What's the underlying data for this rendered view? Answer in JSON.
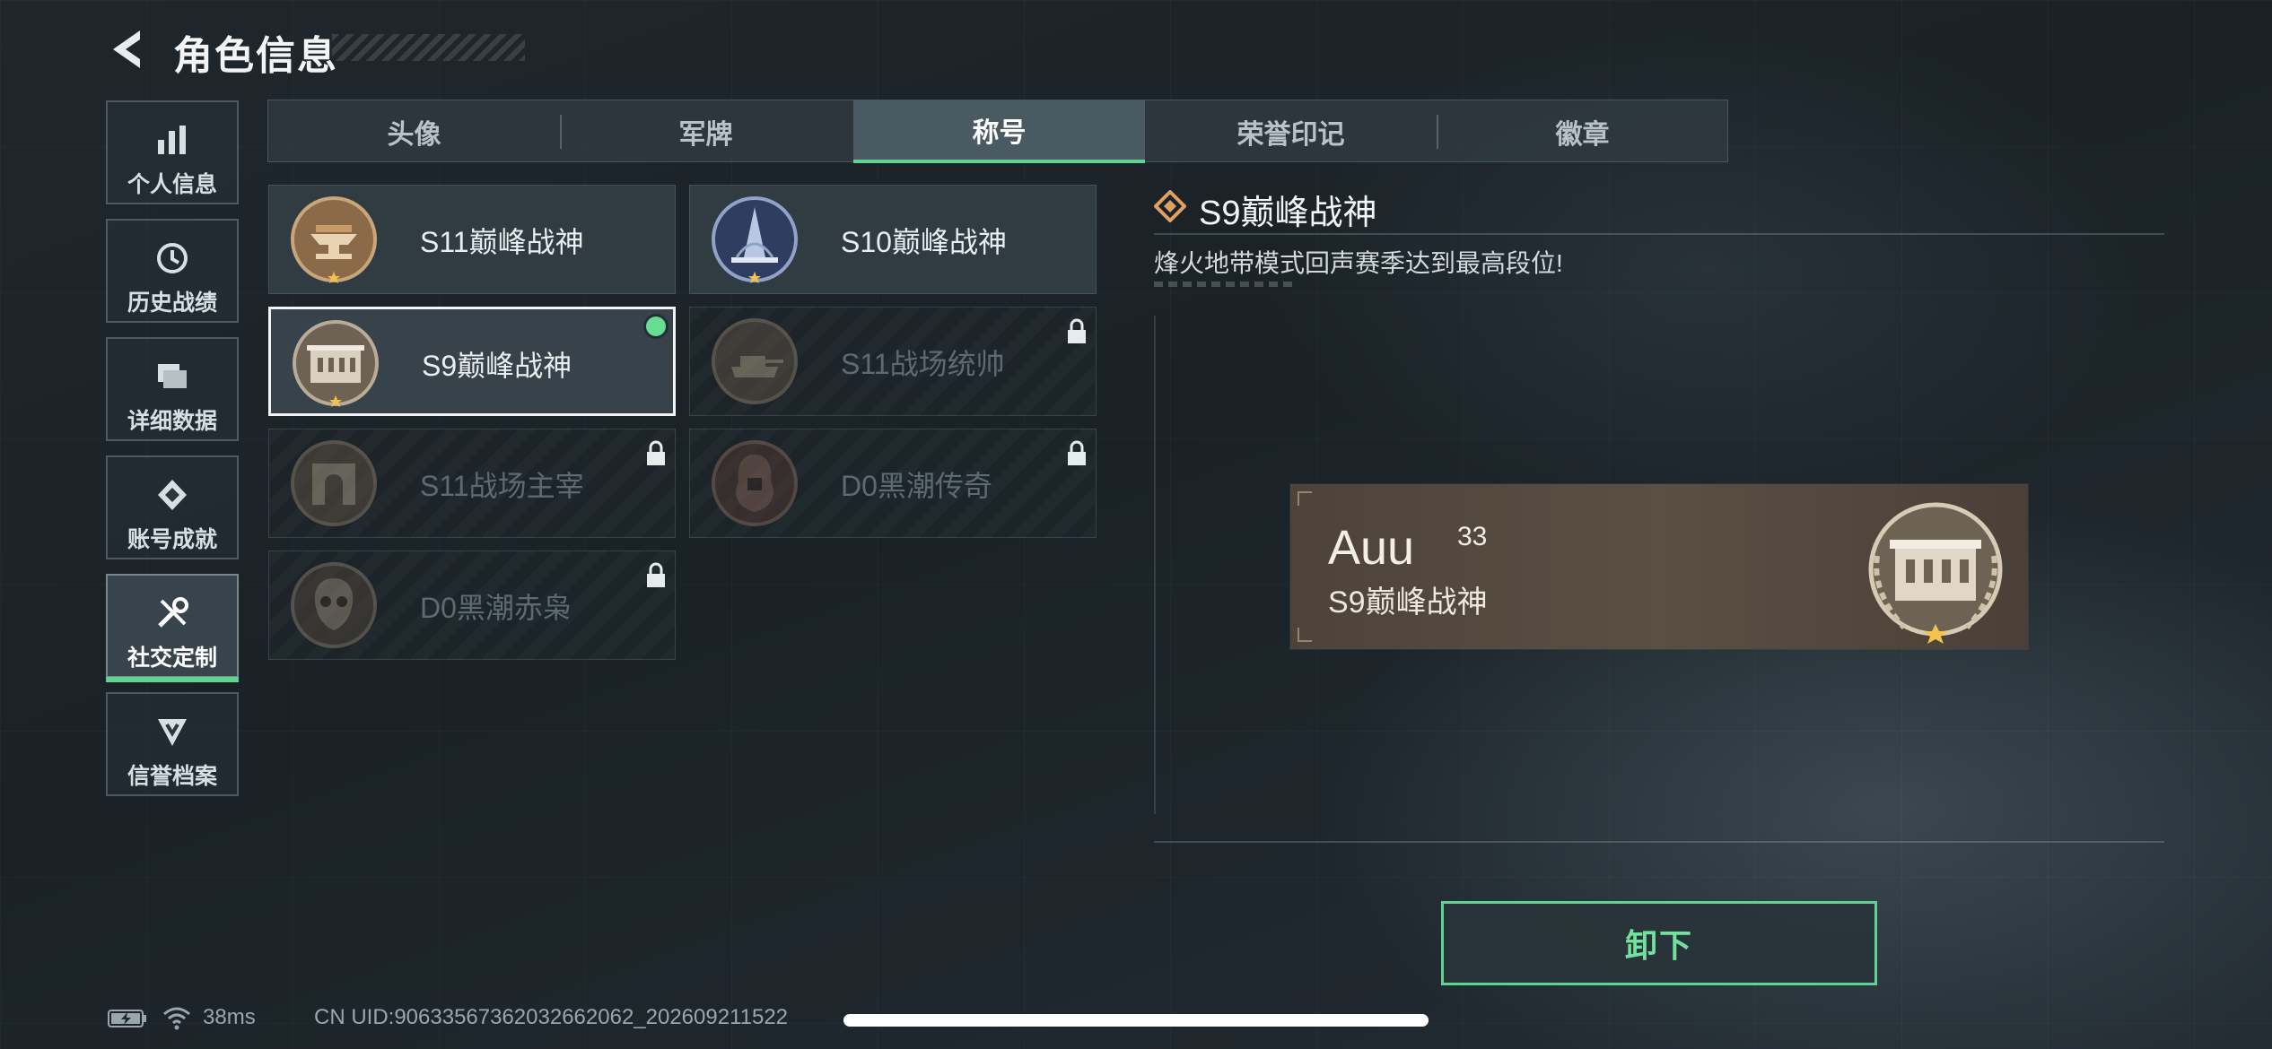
{
  "header": {
    "title": "角色信息",
    "back_icon": "chevron-left-icon"
  },
  "sidebar": {
    "items": [
      {
        "label": "个人信息",
        "icon": "bar-chart-icon"
      },
      {
        "label": "历史战绩",
        "icon": "history-clock-icon"
      },
      {
        "label": "详细数据",
        "icon": "folder-stack-icon"
      },
      {
        "label": "账号成就",
        "icon": "achievement-badge-icon"
      },
      {
        "label": "社交定制",
        "icon": "tools-icon",
        "active": true
      },
      {
        "label": "信誉档案",
        "icon": "shield-chevron-icon"
      }
    ]
  },
  "tabs": [
    {
      "label": "头像"
    },
    {
      "label": "军牌"
    },
    {
      "label": "称号",
      "active": true
    },
    {
      "label": "荣誉印记"
    },
    {
      "label": "徽章"
    }
  ],
  "titles": [
    {
      "name": "S11巅峰战神",
      "locked": false,
      "medal": "anvil-medal-icon"
    },
    {
      "name": "S10巅峰战神",
      "locked": false,
      "medal": "tower-medal-icon"
    },
    {
      "name": "S9巅峰战神",
      "locked": false,
      "selected": true,
      "equipped": true,
      "medal": "fortress-medal-icon"
    },
    {
      "name": "S11战场统帅",
      "locked": true,
      "medal": "tank-medal-icon"
    },
    {
      "name": "S11战场主宰",
      "locked": true,
      "medal": "arch-medal-icon"
    },
    {
      "name": "D0黑潮传奇",
      "locked": true,
      "medal": "hooded-figure-medal-icon"
    },
    {
      "name": "D0黑潮赤枭",
      "locked": true,
      "medal": "skull-mask-medal-icon"
    }
  ],
  "detail": {
    "title": "S9巅峰战神",
    "description": "烽火地带模式回声赛季达到最高段位!",
    "preview": {
      "player_name": "Auu",
      "level": "33",
      "title": "S9巅峰战神"
    },
    "unequip_label": "卸下"
  },
  "status_bar": {
    "ping": "38ms",
    "uid": "CN UID:9063356736203266206​2_202609211522"
  },
  "colors": {
    "accent": "#5fd38f",
    "nameplate": "#564b40"
  }
}
